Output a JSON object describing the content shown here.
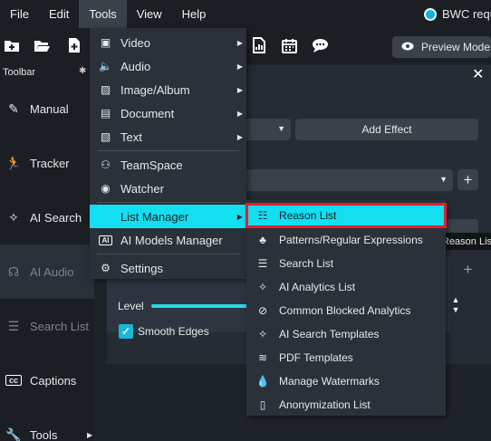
{
  "menubar": {
    "items": [
      "File",
      "Edit",
      "Tools",
      "View",
      "Help"
    ],
    "brand": "BWC requ"
  },
  "toolbar": {
    "icons": [
      "folder-plus-icon",
      "folder-open-icon",
      "file-plus-icon",
      "file-chart-icon",
      "calendar-icon",
      "chat-icon"
    ],
    "preview_label": "Preview Mode"
  },
  "sidebar": {
    "header": "Toolbar",
    "items": [
      {
        "label": "Manual",
        "icon": "pen-icon"
      },
      {
        "label": "Tracker",
        "icon": "runner-icon"
      },
      {
        "label": "AI Search",
        "icon": "magic-wand-icon"
      },
      {
        "label": "AI Audio",
        "icon": "headset-icon"
      },
      {
        "label": "Search List",
        "icon": "list-icon"
      },
      {
        "label": "Captions",
        "icon": "cc-icon"
      },
      {
        "label": "Tools",
        "icon": "wrench-icon"
      }
    ]
  },
  "main": {
    "add_effect": "Add Effect",
    "level_label": "Level",
    "smooth_edges": "Smooth Edges",
    "tooltip": "Reason List"
  },
  "tools_menu": {
    "items": [
      {
        "label": "Video",
        "icon": "video-icon",
        "submenu": true
      },
      {
        "label": "Audio",
        "icon": "speaker-icon",
        "submenu": true
      },
      {
        "label": "Image/Album",
        "icon": "image-icon",
        "submenu": true
      },
      {
        "label": "Document",
        "icon": "document-icon",
        "submenu": true
      },
      {
        "label": "Text",
        "icon": "text-icon",
        "submenu": true
      },
      {
        "label": "TeamSpace",
        "icon": "team-icon",
        "submenu": false
      },
      {
        "label": "Watcher",
        "icon": "eye-icon",
        "submenu": false
      },
      {
        "label": "List Manager",
        "icon": "",
        "submenu": true
      },
      {
        "label": "AI Models Manager",
        "icon": "ai-icon",
        "submenu": false
      },
      {
        "label": "Settings",
        "icon": "gear-icon",
        "submenu": false
      }
    ]
  },
  "list_manager_menu": {
    "items": [
      {
        "label": "Reason List",
        "icon": "reason-list-icon"
      },
      {
        "label": "Patterns/Regular Expressions",
        "icon": "shapes-icon"
      },
      {
        "label": "Search List",
        "icon": "search-list-icon"
      },
      {
        "label": "AI Analytics List",
        "icon": "magic-wand-icon"
      },
      {
        "label": "Common Blocked Analytics",
        "icon": "block-icon"
      },
      {
        "label": "AI Search Templates",
        "icon": "magic-wand-icon"
      },
      {
        "label": "PDF Templates",
        "icon": "layers-icon"
      },
      {
        "label": "Manage Watermarks",
        "icon": "droplet-icon"
      },
      {
        "label": "Anonymization List",
        "icon": "file-question-icon"
      }
    ]
  },
  "colors": {
    "accent": "#12dff0",
    "highlight_border": "#e0202c",
    "background": "#1e2328"
  }
}
